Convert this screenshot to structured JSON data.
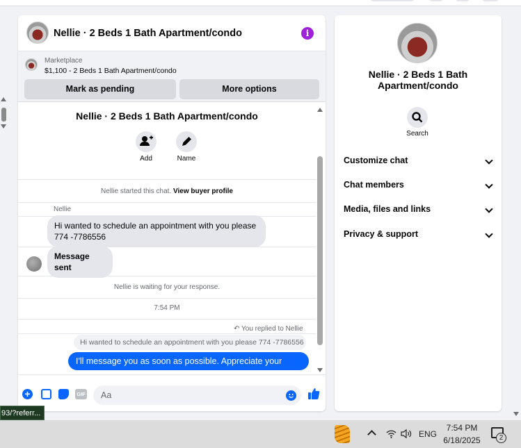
{
  "chat": {
    "header_title": "Nellie · 2 Beds 1 Bath Apartment/condo",
    "marketplace_label": "Marketplace",
    "listing": "$1,100 - 2 Beds 1 Bath Apartment/condo",
    "mark_pending_label": "Mark as pending",
    "more_options_label": "More options",
    "thread_title": "Nellie · 2 Beds 1 Bath Apartment/condo",
    "actions": {
      "add_label": "Add",
      "name_label": "Name"
    },
    "started_text": "Nellie started this chat.",
    "view_profile_label": "View buyer profile",
    "sender_name": "Nellie",
    "messages": {
      "m1": "Hi wanted to schedule an appointment with you please 774 -7786556",
      "m2": "Message sent"
    },
    "waiting_text": "Nellie is waiting for your response.",
    "time": "7:54 PM",
    "replied_label": "You replied to Nellie",
    "quoted_text": "Hi wanted to schedule an appointment with you please  774 -7786556",
    "reply_text": "I'll message you as soon as possible. Appreciate your patience",
    "composer_placeholder": "Aa",
    "gif_label": "GIF"
  },
  "info": {
    "title": "Nellie · 2 Beds 1 Bath Apartment/condo",
    "search_label": "Search",
    "sections": [
      "Customize chat",
      "Chat members",
      "Media, files and links",
      "Privacy & support"
    ]
  },
  "tooltip": "93/?referr...",
  "taskbar": {
    "language": "ENG",
    "time": "7:54 PM",
    "date": "6/18/2025",
    "notifications": "2"
  },
  "colors": {
    "accent": "#0866ff",
    "info_icon": "#a020d8"
  }
}
